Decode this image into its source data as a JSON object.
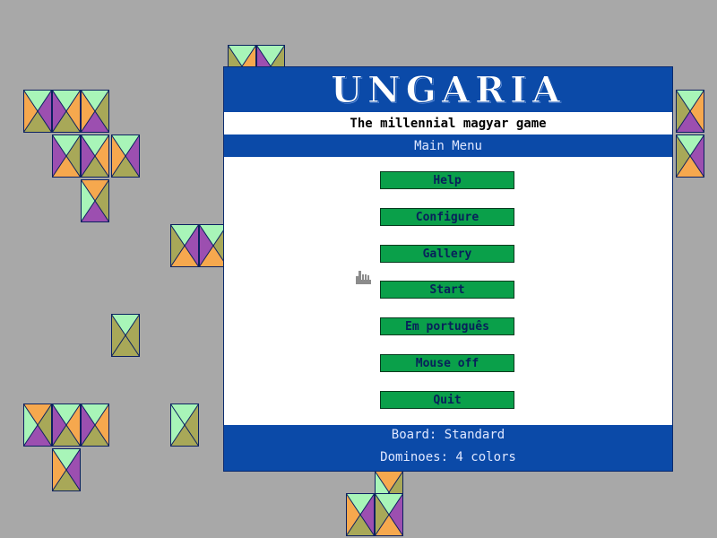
{
  "game": {
    "title": "UNGARIA",
    "subtitle": "The millennial magyar game",
    "menu_title": "Main Menu",
    "menu_items": [
      "Help",
      "Configure",
      "Gallery",
      "Start",
      "Em português",
      "Mouse off",
      "Quit"
    ],
    "board_status": "Board: Standard",
    "dominoes_status": "Dominoes: 4 colors"
  },
  "colors": {
    "background": "#a8a8a8",
    "panel_blue": "#0b4aa8",
    "button_green": "#0aa04a",
    "tile_green": "#a8f5b8",
    "tile_orange": "#f6a84e",
    "tile_purple": "#9c4fb0",
    "tile_olive": "#a8a858"
  },
  "icons": {
    "cursor": "hand-pointer-icon"
  }
}
